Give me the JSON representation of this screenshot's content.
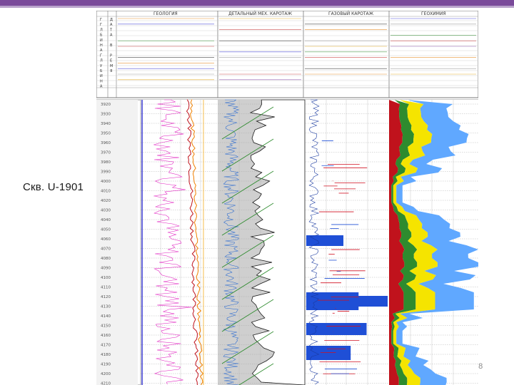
{
  "slide": {
    "well_label": "Скв. U-1901",
    "page_number": "18"
  },
  "header": {
    "track_titles": [
      "ГЕОЛОГИЯ",
      "ДЕТАЛЬНЫЙ МЕХ. КАРОТАЖ",
      "ГАЗОВЫЙ КАРОТАЖ",
      "ГЕОХИМИЯ"
    ],
    "index_letters": [
      "Г",
      "Г",
      "Л",
      "Б",
      "И",
      "Н",
      "А",
      "Г",
      "Л",
      "У",
      "Б",
      "И",
      "Н",
      "А"
    ],
    "index_letters_2": [
      "Д",
      "А",
      "Т",
      "А",
      "",
      "В",
      "",
      "Р",
      "Е",
      "М",
      "Я"
    ]
  },
  "depth_scale": {
    "labels": [
      "3920",
      "3930",
      "3940",
      "3950",
      "3960",
      "3970",
      "3980",
      "3990",
      "4000",
      "4010",
      "4020",
      "4030",
      "4040",
      "4050",
      "4060",
      "4070",
      "4080",
      "4090",
      "4100",
      "4110",
      "4120",
      "4130",
      "4140",
      "4150",
      "4160",
      "4170",
      "4180",
      "4190",
      "4200",
      "4210"
    ]
  },
  "colors": {
    "accent_bar": "#7a4a9a",
    "gas_blue": "#1f4fd6",
    "geochem_red": "#c0121c",
    "geochem_yellow": "#f5e400",
    "geochem_green": "#2e8b2e",
    "geochem_lightblue": "#60a8ff"
  }
}
